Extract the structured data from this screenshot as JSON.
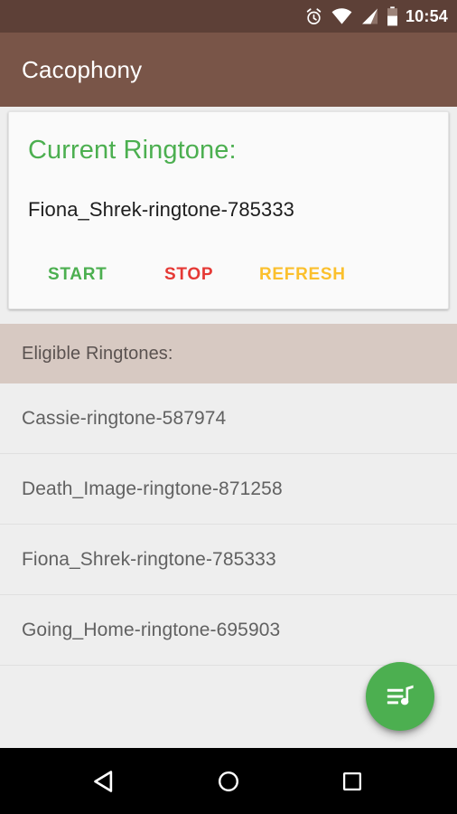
{
  "status_bar": {
    "time": "10:54",
    "icons": [
      "alarm-icon",
      "wifi-icon",
      "signal-icon",
      "battery-icon"
    ],
    "background": "#5D4037"
  },
  "app_bar": {
    "title": "Cacophony",
    "background": "#795548",
    "title_color": "#FFFFFF"
  },
  "card": {
    "title": "Current Ringtone:",
    "title_color": "#4CAF50",
    "current_ringtone": "Fiona_Shrek-ringtone-785333",
    "actions": [
      {
        "label": "START",
        "color": "#4CAF50"
      },
      {
        "label": "STOP",
        "color": "#E53935"
      },
      {
        "label": "REFRESH",
        "color": "#FBC02D"
      }
    ]
  },
  "list_section": {
    "header": "Eligible Ringtones:",
    "header_background": "#D7C9C2",
    "items": [
      {
        "label": "Cassie-ringtone-587974"
      },
      {
        "label": "Death_Image-ringtone-871258"
      },
      {
        "label": "Fiona_Shrek-ringtone-785333"
      },
      {
        "label": "Going_Home-ringtone-695903"
      }
    ]
  },
  "fab": {
    "icon": "queue-music-icon",
    "background": "#4CAF50",
    "icon_color": "#FFFFFF"
  },
  "nav_bar": {
    "background": "#000000",
    "buttons": [
      {
        "icon": "back-triangle-icon"
      },
      {
        "icon": "home-circle-icon"
      },
      {
        "icon": "recents-square-icon"
      }
    ]
  }
}
